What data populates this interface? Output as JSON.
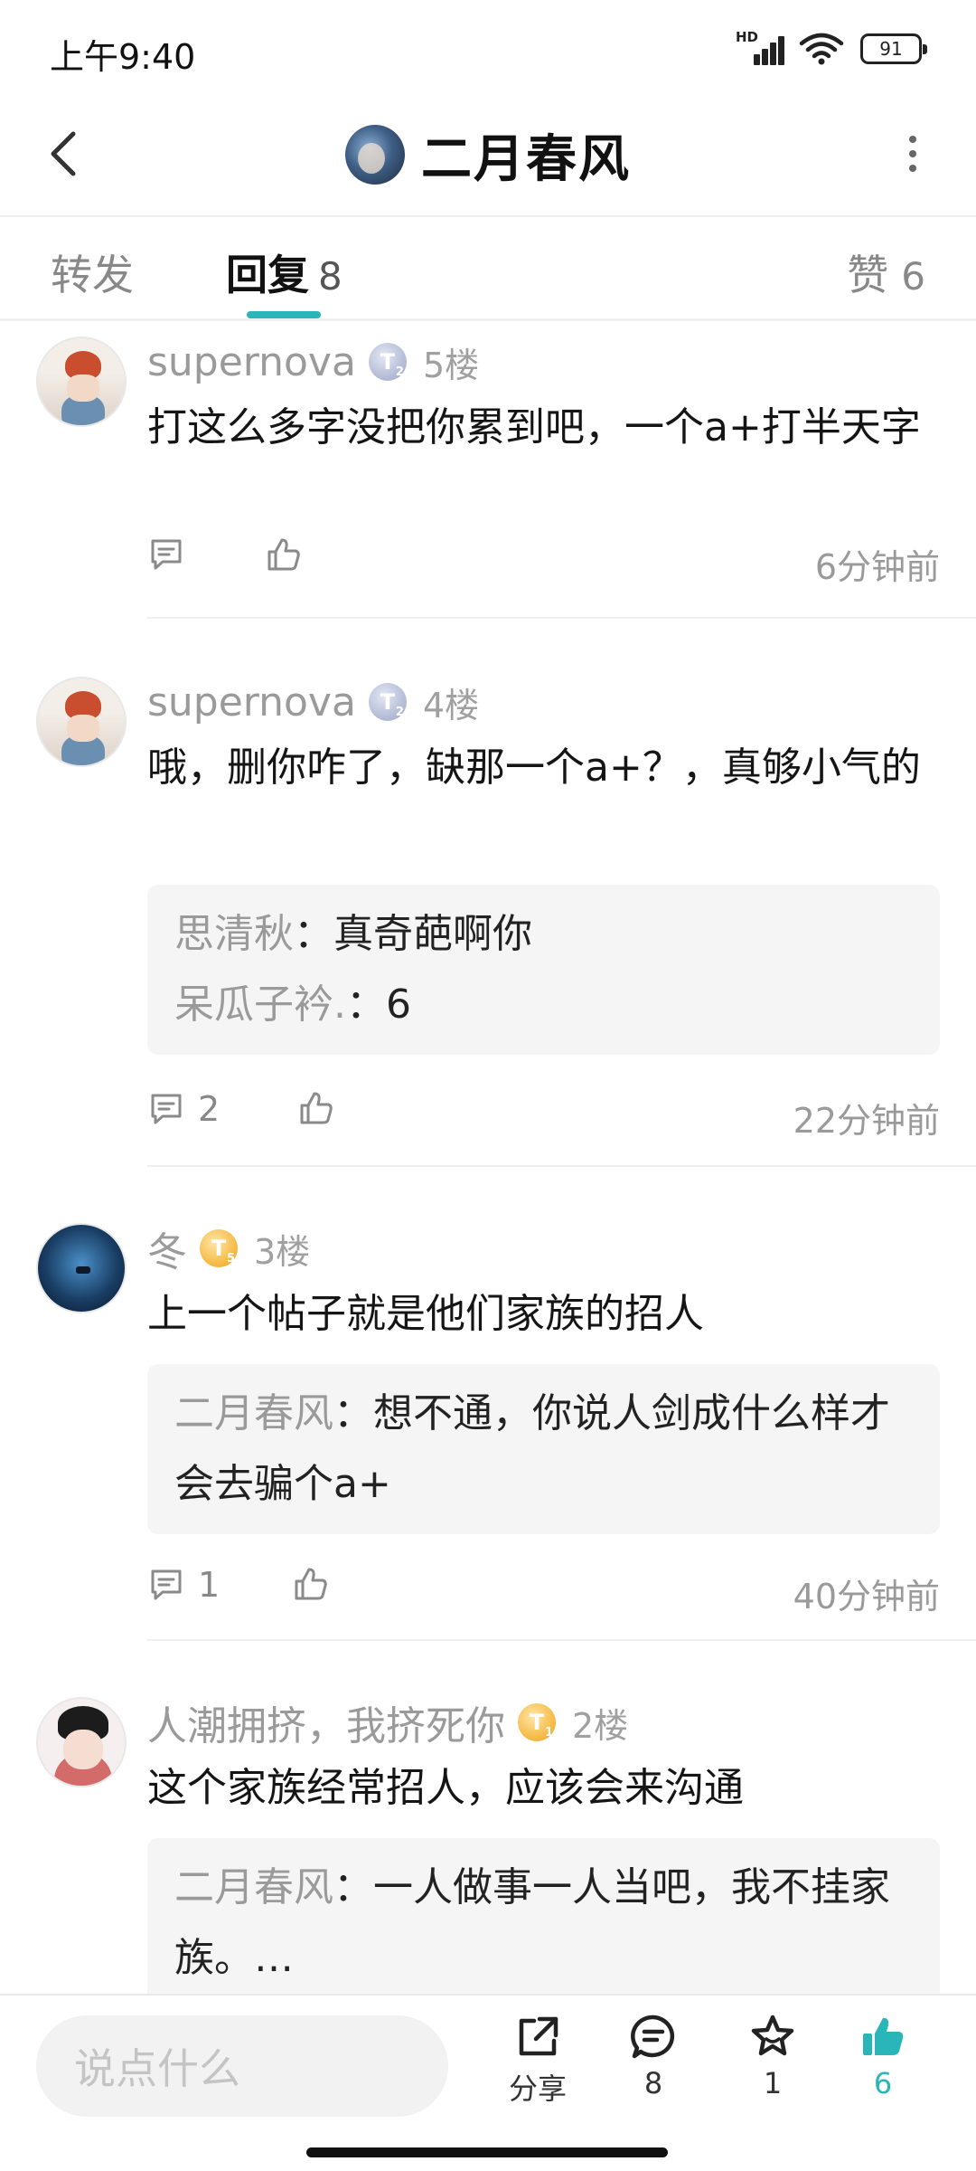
{
  "status_bar": {
    "time": "上午9:40",
    "network": "HD",
    "battery": "91"
  },
  "header": {
    "title": "二月春风"
  },
  "tabs": {
    "repost": {
      "label": "转发"
    },
    "reply": {
      "label": "回复",
      "count": "8"
    },
    "like": {
      "label": "赞",
      "count": "6"
    }
  },
  "comments": [
    {
      "name": "supernova",
      "badge": "T",
      "badge_level": "2",
      "floor": "5楼",
      "text": "打这么多字没把你累到吧，一个a+打半天字",
      "comment_count": "",
      "time": "6分钟前",
      "replies": []
    },
    {
      "name": "supernova",
      "badge": "T",
      "badge_level": "2",
      "floor": "4楼",
      "text": "哦，删你咋了，缺那一个a+？，真够小气的",
      "comment_count": "2",
      "time": "22分钟前",
      "replies": [
        {
          "name": "思清秋",
          "text": "：真奇葩啊你"
        },
        {
          "name": "呆瓜子衿.",
          "text": "：6"
        }
      ]
    },
    {
      "name": "冬",
      "badge": "T",
      "badge_level": "5",
      "floor": "3楼",
      "text": "上一个帖子就是他们家族的招人",
      "comment_count": "1",
      "time": "40分钟前",
      "replies": [
        {
          "name": "二月春风",
          "text": "：想不通，你说人剑成什么样才会去骗个a+"
        }
      ]
    },
    {
      "name": "人潮拥挤，我挤死你",
      "badge": "T",
      "badge_level": "1",
      "floor": "2楼",
      "text": "这个家族经常招人，应该会来沟通",
      "comment_count": "",
      "time": "",
      "replies": [
        {
          "name": "二月春风",
          "text": "：一人做事一人当吧，我不挂家族。…"
        }
      ]
    }
  ],
  "bottom_bar": {
    "input_placeholder": "说点什么",
    "share_label": "分享",
    "comment_count": "8",
    "favorite_count": "1",
    "like_count": "6"
  },
  "colors": {
    "accent": "#2ab5b8",
    "secondary_text": "#9a9a9a",
    "quote_bg": "#f5f5f5"
  }
}
